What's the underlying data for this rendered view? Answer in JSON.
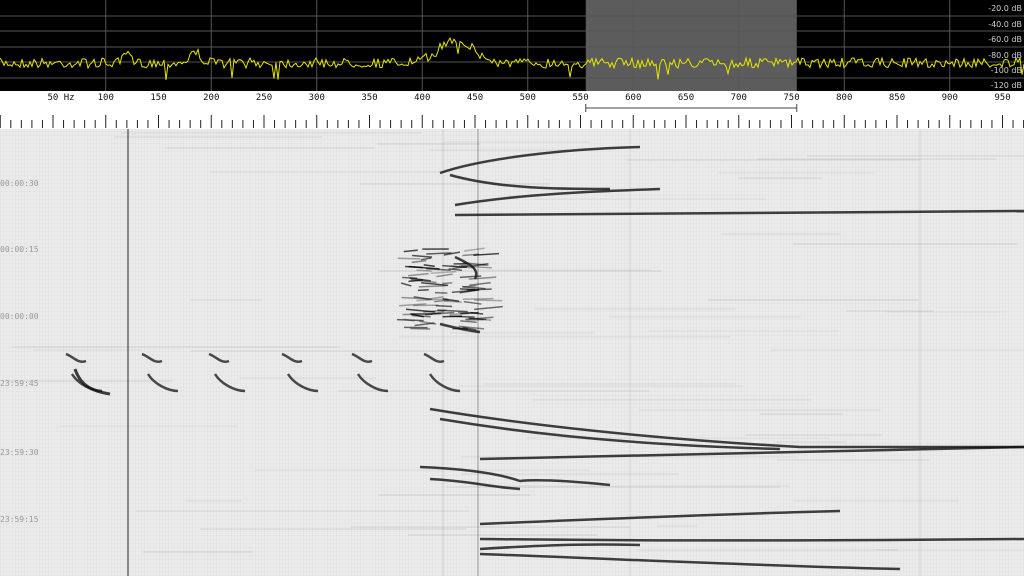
{
  "spectrum": {
    "db_labels": [
      "-20.0 dB",
      "-40.0 dB",
      "-60.0 dB",
      "-80.0 dB",
      "-100 dB",
      "-120 dB"
    ],
    "selection": {
      "from_hz": 555,
      "to_hz": 755
    },
    "trace_color": "#e6e600",
    "highlight_color": "#5c5c5c"
  },
  "ruler": {
    "unit_label": "50 Hz",
    "freq_labels": [
      "100",
      "150",
      "200",
      "250",
      "300",
      "350",
      "400",
      "450",
      "500",
      "550",
      "600",
      "650",
      "700",
      "750",
      "800",
      "850",
      "900",
      "950"
    ]
  },
  "waterfall": {
    "time_labels": [
      "00:00:30",
      "00:00:15",
      "00:00:00",
      "23:59:45",
      "23:59:30",
      "23:59:15"
    ]
  }
}
